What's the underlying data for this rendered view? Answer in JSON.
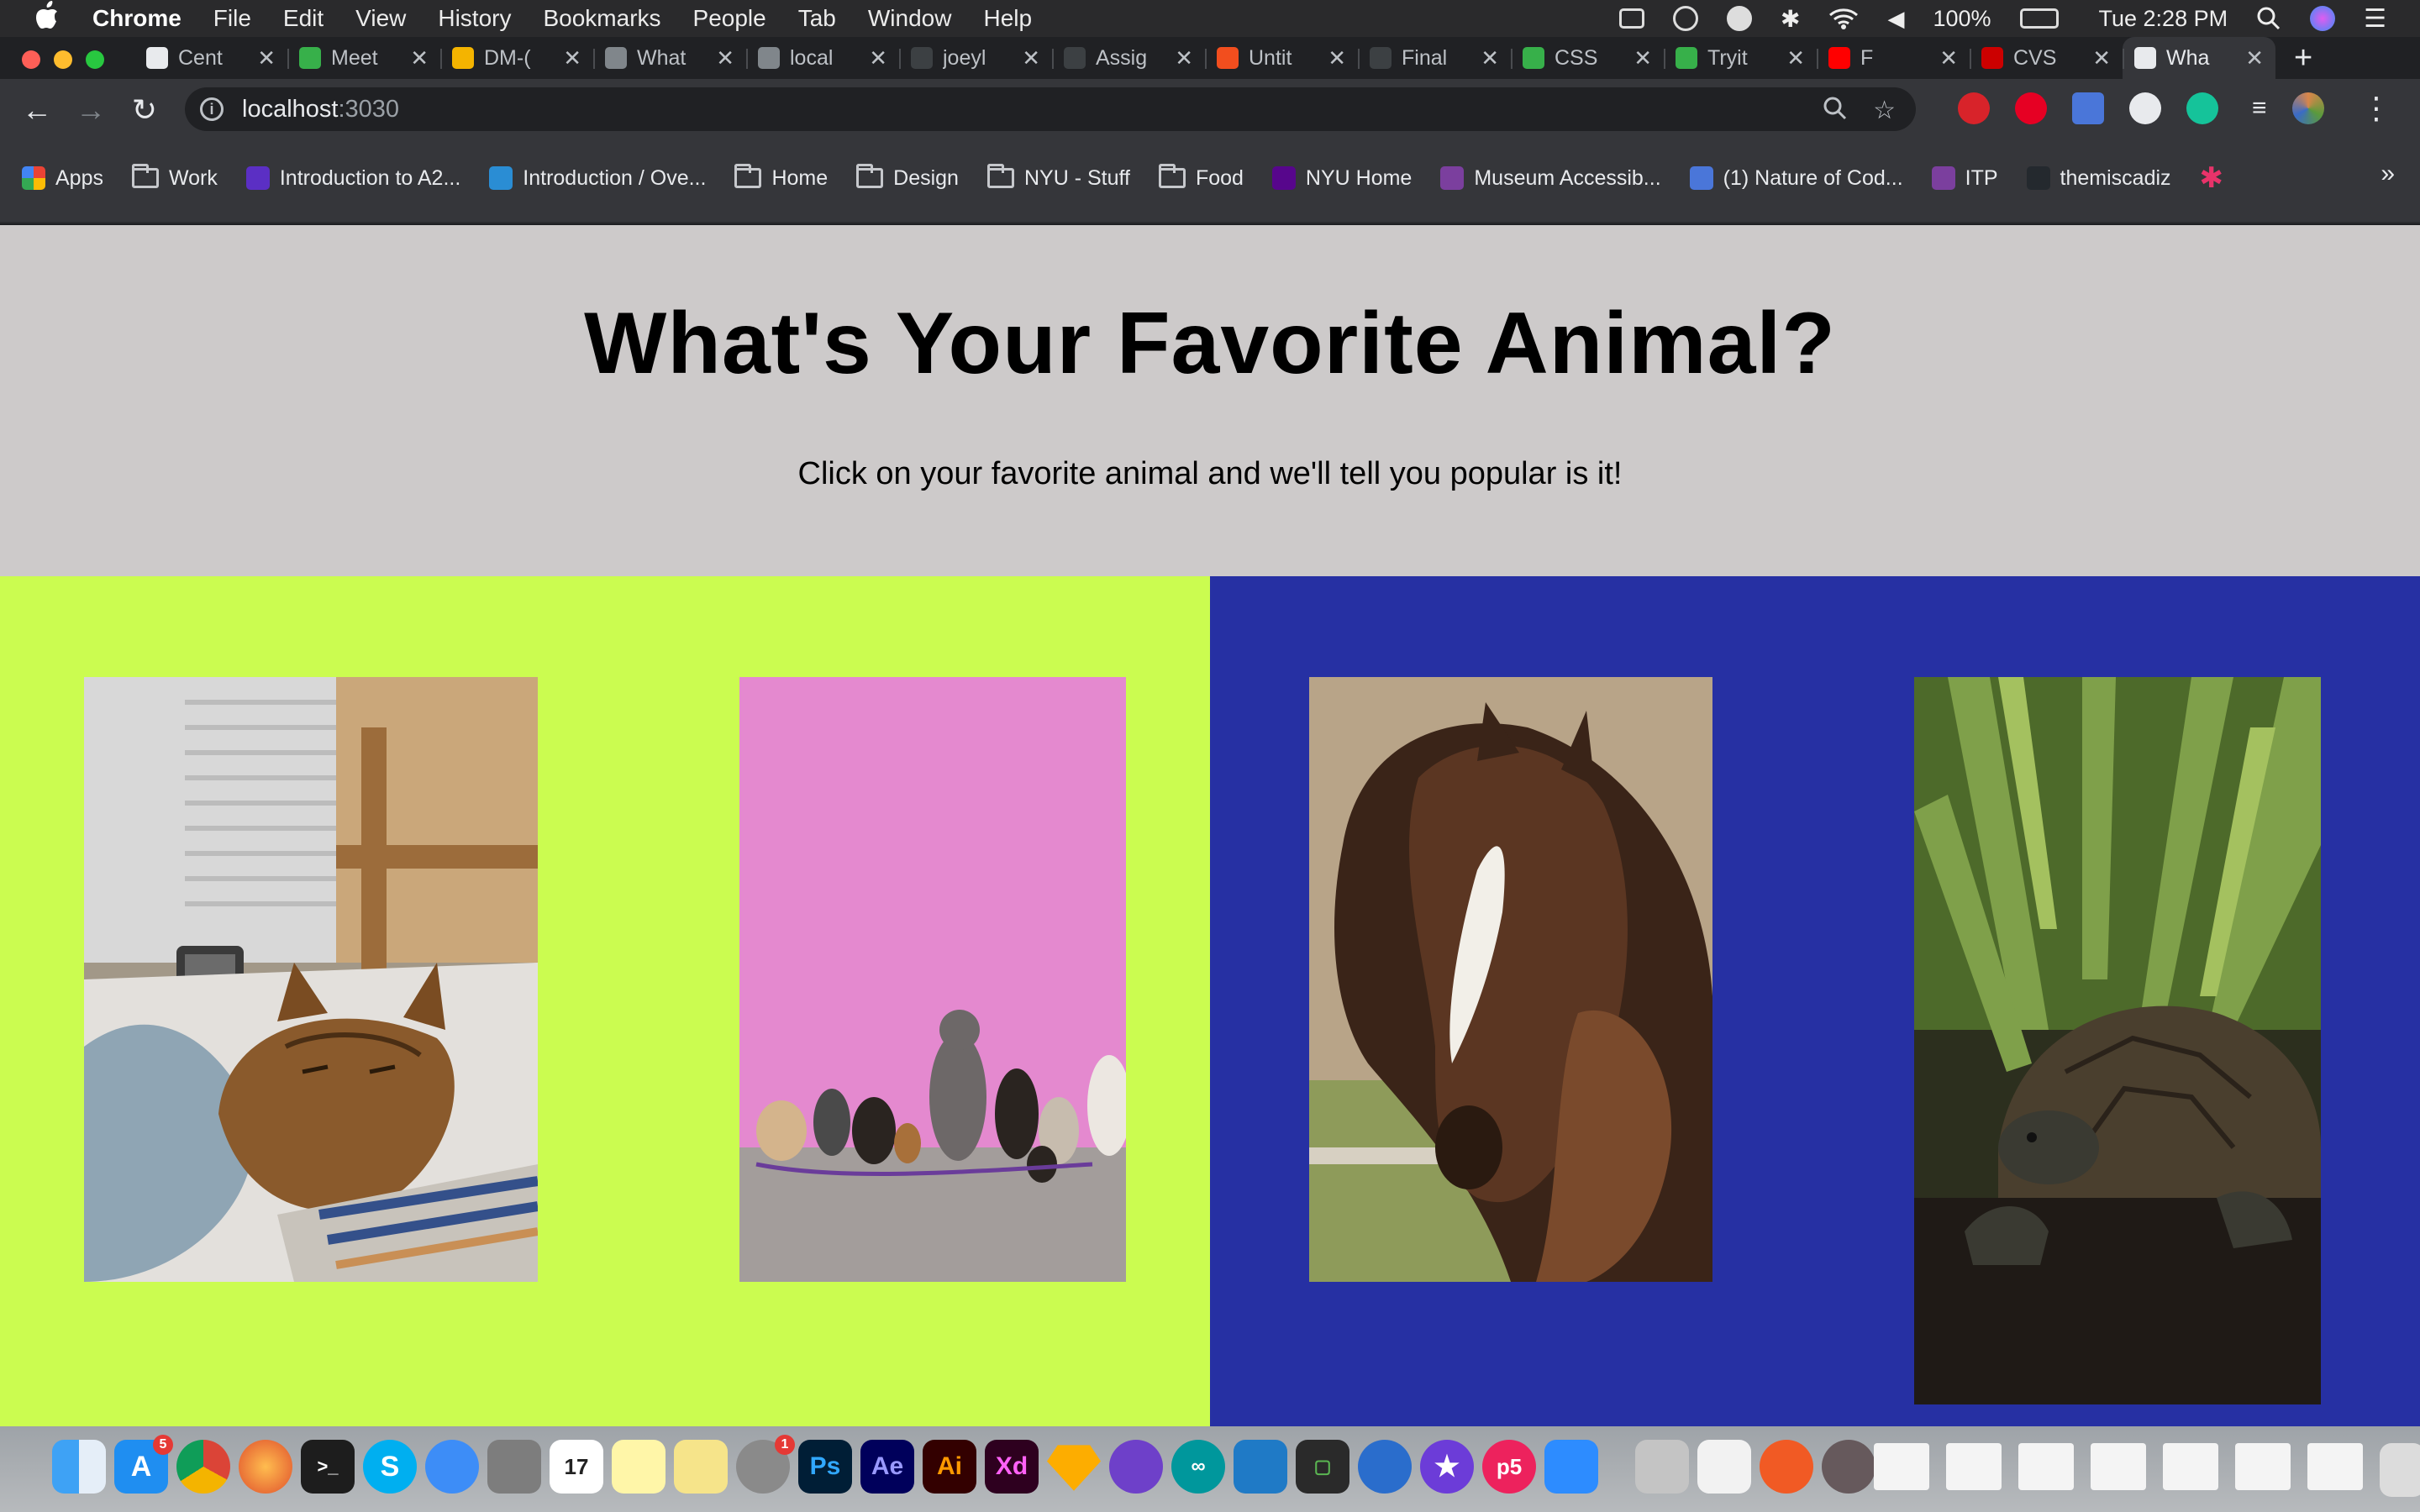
{
  "menubar": {
    "app_name": "Chrome",
    "items": [
      "File",
      "Edit",
      "View",
      "History",
      "Bookmarks",
      "People",
      "Tab",
      "Window",
      "Help"
    ],
    "battery": "100%",
    "clock": "Tue 2:28 PM"
  },
  "tabs": [
    {
      "title": "Cent",
      "color": "#e8eaed"
    },
    {
      "title": "Meet",
      "color": "#37b04a"
    },
    {
      "title": "DM-(",
      "color": "#f4b400"
    },
    {
      "title": "What",
      "color": "#80868b"
    },
    {
      "title": "local",
      "color": "#80868b"
    },
    {
      "title": "joeyl",
      "color": "#3c4043"
    },
    {
      "title": "Assig",
      "color": "#3c4043"
    },
    {
      "title": "Untit",
      "color": "#f24e1e"
    },
    {
      "title": "Final",
      "color": "#3c4043"
    },
    {
      "title": "CSS",
      "color": "#37b04a"
    },
    {
      "title": "Tryit",
      "color": "#37b04a"
    },
    {
      "title": "F",
      "color": "#ff0000"
    },
    {
      "title": "CVS",
      "color": "#cc0000"
    },
    {
      "title": "Wha",
      "color": "#e8eaed"
    }
  ],
  "address": {
    "host": "localhost",
    "port": ":3030"
  },
  "bookmarks": [
    {
      "label": "Apps",
      "kind": "apps"
    },
    {
      "label": "Work",
      "kind": "folder"
    },
    {
      "label": "Introduction to A2...",
      "kind": "site",
      "color": "#5b2fc4"
    },
    {
      "label": "Introduction / Ove...",
      "kind": "site",
      "color": "#2a8dd4"
    },
    {
      "label": "Home",
      "kind": "folder"
    },
    {
      "label": "Design",
      "kind": "folder"
    },
    {
      "label": "NYU - Stuff",
      "kind": "folder"
    },
    {
      "label": "Food",
      "kind": "folder"
    },
    {
      "label": "NYU Home",
      "kind": "site",
      "color": "#57068c"
    },
    {
      "label": "Museum Accessib...",
      "kind": "site",
      "color": "#7b3f9e"
    },
    {
      "label": "(1) Nature of Cod...",
      "kind": "site",
      "color": "#4a76d9"
    },
    {
      "label": "ITP",
      "kind": "site",
      "color": "#7b3f9e"
    },
    {
      "label": "themiscadiz",
      "kind": "site",
      "color": "#24292e"
    }
  ],
  "page": {
    "heading": "What's Your Favorite Animal?",
    "subheading": "Click on your favorite animal and we'll tell you popular is it!",
    "animals": [
      {
        "name": "cat",
        "side": "lime"
      },
      {
        "name": "dogs",
        "side": "lime"
      },
      {
        "name": "horse",
        "side": "blue"
      },
      {
        "name": "tortoise",
        "side": "blue"
      }
    ],
    "colors": {
      "lime": "#cbfc50",
      "blue": "#2630a3",
      "header_bg": "#cdcaca"
    }
  }
}
